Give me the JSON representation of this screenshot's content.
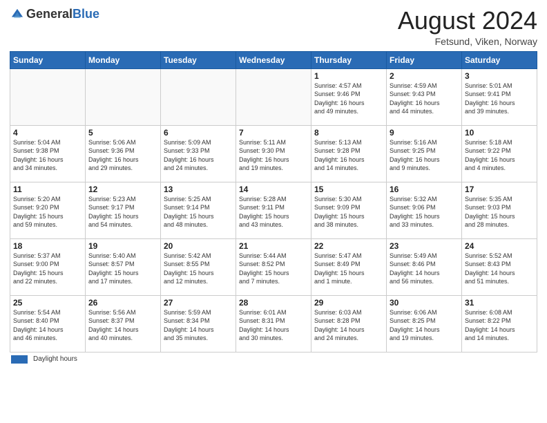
{
  "header": {
    "logo_general": "General",
    "logo_blue": "Blue",
    "month_year": "August 2024",
    "location": "Fetsund, Viken, Norway"
  },
  "days_of_week": [
    "Sunday",
    "Monday",
    "Tuesday",
    "Wednesday",
    "Thursday",
    "Friday",
    "Saturday"
  ],
  "weeks": [
    [
      {
        "day": "",
        "info": ""
      },
      {
        "day": "",
        "info": ""
      },
      {
        "day": "",
        "info": ""
      },
      {
        "day": "",
        "info": ""
      },
      {
        "day": "1",
        "info": "Sunrise: 4:57 AM\nSunset: 9:46 PM\nDaylight: 16 hours\nand 49 minutes."
      },
      {
        "day": "2",
        "info": "Sunrise: 4:59 AM\nSunset: 9:43 PM\nDaylight: 16 hours\nand 44 minutes."
      },
      {
        "day": "3",
        "info": "Sunrise: 5:01 AM\nSunset: 9:41 PM\nDaylight: 16 hours\nand 39 minutes."
      }
    ],
    [
      {
        "day": "4",
        "info": "Sunrise: 5:04 AM\nSunset: 9:38 PM\nDaylight: 16 hours\nand 34 minutes."
      },
      {
        "day": "5",
        "info": "Sunrise: 5:06 AM\nSunset: 9:36 PM\nDaylight: 16 hours\nand 29 minutes."
      },
      {
        "day": "6",
        "info": "Sunrise: 5:09 AM\nSunset: 9:33 PM\nDaylight: 16 hours\nand 24 minutes."
      },
      {
        "day": "7",
        "info": "Sunrise: 5:11 AM\nSunset: 9:30 PM\nDaylight: 16 hours\nand 19 minutes."
      },
      {
        "day": "8",
        "info": "Sunrise: 5:13 AM\nSunset: 9:28 PM\nDaylight: 16 hours\nand 14 minutes."
      },
      {
        "day": "9",
        "info": "Sunrise: 5:16 AM\nSunset: 9:25 PM\nDaylight: 16 hours\nand 9 minutes."
      },
      {
        "day": "10",
        "info": "Sunrise: 5:18 AM\nSunset: 9:22 PM\nDaylight: 16 hours\nand 4 minutes."
      }
    ],
    [
      {
        "day": "11",
        "info": "Sunrise: 5:20 AM\nSunset: 9:20 PM\nDaylight: 15 hours\nand 59 minutes."
      },
      {
        "day": "12",
        "info": "Sunrise: 5:23 AM\nSunset: 9:17 PM\nDaylight: 15 hours\nand 54 minutes."
      },
      {
        "day": "13",
        "info": "Sunrise: 5:25 AM\nSunset: 9:14 PM\nDaylight: 15 hours\nand 48 minutes."
      },
      {
        "day": "14",
        "info": "Sunrise: 5:28 AM\nSunset: 9:11 PM\nDaylight: 15 hours\nand 43 minutes."
      },
      {
        "day": "15",
        "info": "Sunrise: 5:30 AM\nSunset: 9:09 PM\nDaylight: 15 hours\nand 38 minutes."
      },
      {
        "day": "16",
        "info": "Sunrise: 5:32 AM\nSunset: 9:06 PM\nDaylight: 15 hours\nand 33 minutes."
      },
      {
        "day": "17",
        "info": "Sunrise: 5:35 AM\nSunset: 9:03 PM\nDaylight: 15 hours\nand 28 minutes."
      }
    ],
    [
      {
        "day": "18",
        "info": "Sunrise: 5:37 AM\nSunset: 9:00 PM\nDaylight: 15 hours\nand 22 minutes."
      },
      {
        "day": "19",
        "info": "Sunrise: 5:40 AM\nSunset: 8:57 PM\nDaylight: 15 hours\nand 17 minutes."
      },
      {
        "day": "20",
        "info": "Sunrise: 5:42 AM\nSunset: 8:55 PM\nDaylight: 15 hours\nand 12 minutes."
      },
      {
        "day": "21",
        "info": "Sunrise: 5:44 AM\nSunset: 8:52 PM\nDaylight: 15 hours\nand 7 minutes."
      },
      {
        "day": "22",
        "info": "Sunrise: 5:47 AM\nSunset: 8:49 PM\nDaylight: 15 hours\nand 1 minute."
      },
      {
        "day": "23",
        "info": "Sunrise: 5:49 AM\nSunset: 8:46 PM\nDaylight: 14 hours\nand 56 minutes."
      },
      {
        "day": "24",
        "info": "Sunrise: 5:52 AM\nSunset: 8:43 PM\nDaylight: 14 hours\nand 51 minutes."
      }
    ],
    [
      {
        "day": "25",
        "info": "Sunrise: 5:54 AM\nSunset: 8:40 PM\nDaylight: 14 hours\nand 46 minutes."
      },
      {
        "day": "26",
        "info": "Sunrise: 5:56 AM\nSunset: 8:37 PM\nDaylight: 14 hours\nand 40 minutes."
      },
      {
        "day": "27",
        "info": "Sunrise: 5:59 AM\nSunset: 8:34 PM\nDaylight: 14 hours\nand 35 minutes."
      },
      {
        "day": "28",
        "info": "Sunrise: 6:01 AM\nSunset: 8:31 PM\nDaylight: 14 hours\nand 30 minutes."
      },
      {
        "day": "29",
        "info": "Sunrise: 6:03 AM\nSunset: 8:28 PM\nDaylight: 14 hours\nand 24 minutes."
      },
      {
        "day": "30",
        "info": "Sunrise: 6:06 AM\nSunset: 8:25 PM\nDaylight: 14 hours\nand 19 minutes."
      },
      {
        "day": "31",
        "info": "Sunrise: 6:08 AM\nSunset: 8:22 PM\nDaylight: 14 hours\nand 14 minutes."
      }
    ]
  ],
  "footer": {
    "daylight_label": "Daylight hours"
  }
}
